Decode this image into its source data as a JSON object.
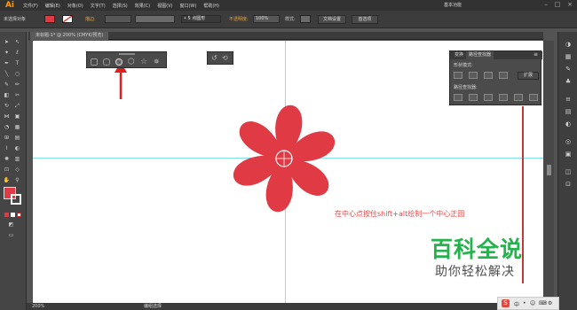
{
  "app": {
    "logo": "Ai"
  },
  "menubar": {
    "items": [
      "文件(F)",
      "编辑(E)",
      "对象(O)",
      "文字(T)",
      "选择(S)",
      "效果(C)",
      "视图(V)",
      "窗口(W)",
      "帮助(H)"
    ],
    "workspace": "基本功能"
  },
  "control_bar": {
    "selection_label": "未选择对象",
    "stroke_label": "描边:",
    "brush_size": "• 5 点圆形",
    "opacity_label": "不透明度:",
    "opacity_value": "100%",
    "style_label": "样式:",
    "doc_setup_button": "文档设置",
    "preferences_button": "首选项",
    "fill_color": "#e03a45"
  },
  "document": {
    "tab_title": "未标题-1* @ 200% (CMYK/预览)"
  },
  "pathfinder_panel": {
    "tabs": [
      "变换",
      "路径查找器"
    ],
    "shape_modes_label": "形状模式:",
    "expand_button": "扩展",
    "pathfinder_label": "路径查找器:"
  },
  "canvas": {
    "annotation": "在中心点按住shift+alt绘制一个中心正圆",
    "flower_color": "#e03a45",
    "arrow_color": "#e02020"
  },
  "watermark": {
    "title": "百科全说",
    "subtitle": "助你轻松解决"
  },
  "statusbar": {
    "zoom": "200%",
    "tool": "编组选择"
  }
}
